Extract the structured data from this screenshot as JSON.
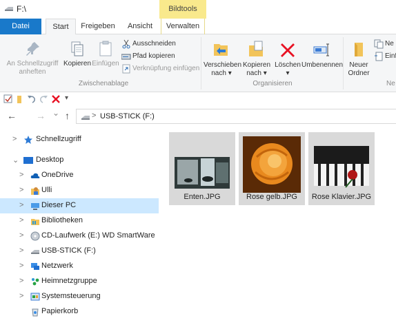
{
  "window": {
    "title": "F:\\",
    "context_tab": "Bildtools"
  },
  "tabs": [
    {
      "label": "Datei"
    },
    {
      "label": "Start"
    },
    {
      "label": "Freigeben"
    },
    {
      "label": "Ansicht"
    },
    {
      "label": "Verwalten"
    }
  ],
  "ribbon": {
    "clipboard": {
      "pin_label_1": "An Schnellzugriff",
      "pin_label_2": "anheften",
      "copy": "Kopieren",
      "paste": "Einfügen",
      "cut": "Ausschneiden",
      "copy_path": "Pfad kopieren",
      "paste_link": "Verknüpfung einfügen",
      "group": "Zwischenablage"
    },
    "organize": {
      "move_1": "Verschieben",
      "move_2": "nach ▾",
      "copy_to_1": "Kopieren",
      "copy_to_2": "nach ▾",
      "delete_1": "Löschen",
      "delete_2": "▾",
      "rename": "Umbenennen",
      "group": "Organisieren"
    },
    "new": {
      "folder_1": "Neuer",
      "folder_2": "Ordner",
      "item": "Ne",
      "easy": "Einf",
      "group": "Ne"
    }
  },
  "qat": {
    "more": "▾"
  },
  "address": {
    "back": "←",
    "forward": "→",
    "recent": "⌄",
    "up": "↑",
    "path": "USB-STICK (F:)",
    "sep": ">"
  },
  "nav": [
    {
      "label": "Schnellzugriff",
      "exp": ">"
    },
    {
      "label": "Desktop",
      "exp": "⌄"
    },
    {
      "label": "OneDrive",
      "exp": ">"
    },
    {
      "label": "Ulli",
      "exp": ">"
    },
    {
      "label": "Dieser PC",
      "exp": ">"
    },
    {
      "label": "Bibliotheken",
      "exp": ">"
    },
    {
      "label": "CD-Laufwerk (E:) WD SmartWare",
      "exp": ">"
    },
    {
      "label": "USB-STICK (F:)",
      "exp": ">"
    },
    {
      "label": "Netzwerk",
      "exp": ">"
    },
    {
      "label": "Heimnetzgruppe",
      "exp": ">"
    },
    {
      "label": "Systemsteuerung",
      "exp": ">"
    },
    {
      "label": "Papierkorb",
      "exp": ""
    }
  ],
  "files": [
    {
      "name": "Enten.JPG"
    },
    {
      "name": "Rose gelb.JPG"
    },
    {
      "name": "Rose Klavier.JPG"
    }
  ],
  "colors": {
    "accent": "#1979ca",
    "context_tab": "#f9e98c",
    "selection": "#cce8ff",
    "delete_red": "#e81123"
  }
}
